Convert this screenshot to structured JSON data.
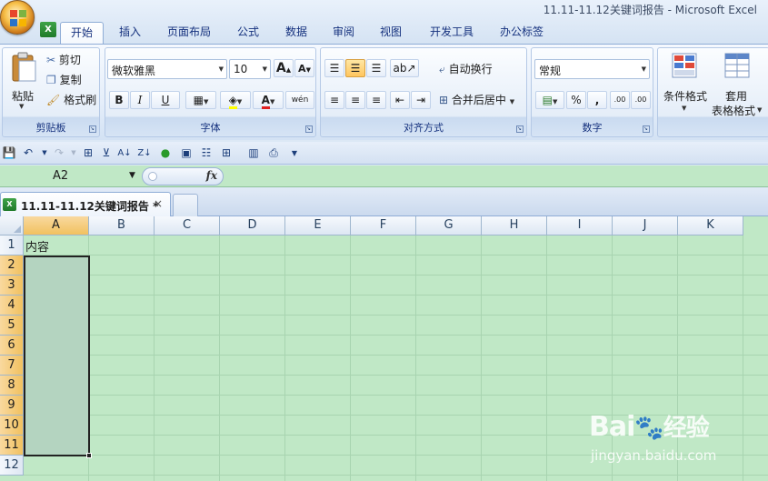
{
  "window": {
    "title": "11.11-11.12关键词报告 - Microsoft Excel"
  },
  "ribbon_tabs": [
    "开始",
    "插入",
    "页面布局",
    "公式",
    "数据",
    "审阅",
    "视图",
    "开发工具",
    "办公标签"
  ],
  "active_tab": "开始",
  "clipboard": {
    "paste": "粘贴",
    "cut": "剪切",
    "copy": "复制",
    "format_painter": "格式刷",
    "label": "剪贴板"
  },
  "font": {
    "name": "微软雅黑",
    "size": "10",
    "grow": "A",
    "shrink": "A",
    "bold": "B",
    "italic": "I",
    "underline": "U",
    "font_color": "A",
    "phonetic": "wén",
    "label": "字体"
  },
  "alignment": {
    "wrap_text": "自动换行",
    "merge_center": "合并后居中",
    "label": "对齐方式"
  },
  "number": {
    "format": "常规",
    "percent": "%",
    "comma": ",",
    "inc_decimal": ".00",
    "dec_decimal": ".00",
    "label": "数字"
  },
  "styles": {
    "conditional": "条件格式",
    "table_line1": "套用",
    "table_line2": "表格格式"
  },
  "formula_bar": {
    "name_box": "A2",
    "fx": "fx"
  },
  "workbook_tab": {
    "name": "11.11-11.12关键词报告 *",
    "close": "×"
  },
  "columns": [
    "A",
    "B",
    "C",
    "D",
    "E",
    "F",
    "G",
    "H",
    "I",
    "J",
    "K"
  ],
  "rows": [
    "1",
    "2",
    "3",
    "4",
    "5",
    "6",
    "7",
    "8",
    "9",
    "10",
    "11",
    "12"
  ],
  "cells": {
    "A1": "内容"
  },
  "selection": {
    "range": "A2:A11"
  },
  "watermark": {
    "logo": "Bai",
    "logo2": "经验",
    "url": "jingyan.baidu.com"
  }
}
